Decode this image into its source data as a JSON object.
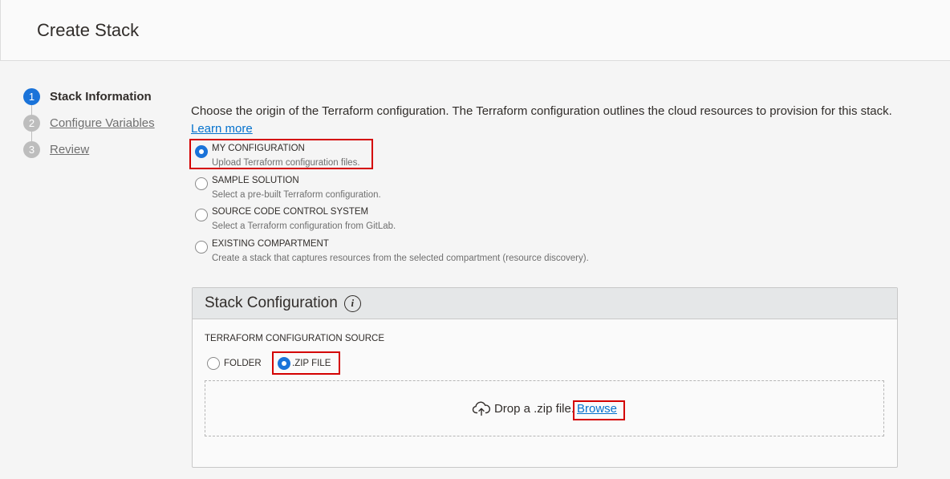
{
  "header": {
    "title": "Create Stack"
  },
  "steps": [
    {
      "number": "1",
      "label": "Stack Information",
      "active": true
    },
    {
      "number": "2",
      "label": "Configure Variables",
      "active": false
    },
    {
      "number": "3",
      "label": "Review",
      "active": false
    }
  ],
  "intro": {
    "text": "Choose the origin of the Terraform configuration. The Terraform configuration outlines the cloud resources to provision for this stack.",
    "learn_more": "Learn more"
  },
  "origin_options": [
    {
      "title": "MY CONFIGURATION",
      "description": "Upload Terraform configuration files.",
      "selected": true
    },
    {
      "title": "SAMPLE SOLUTION",
      "description": "Select a pre-built Terraform configuration.",
      "selected": false
    },
    {
      "title": "SOURCE CODE CONTROL SYSTEM",
      "description": "Select a Terraform configuration from GitLab.",
      "selected": false
    },
    {
      "title": "EXISTING COMPARTMENT",
      "description": "Create a stack that captures resources from the selected compartment (resource discovery).",
      "selected": false
    }
  ],
  "stack_config": {
    "title": "Stack Configuration",
    "info_icon": "i",
    "source_label": "TERRAFORM CONFIGURATION SOURCE",
    "folder_label": "FOLDER",
    "zip_label": ".ZIP FILE",
    "selected_source": "zip",
    "drop_text": "Drop a .zip file.",
    "browse_label": "Browse"
  },
  "colors": {
    "accent": "#1a73d9",
    "link": "#0572ce",
    "highlight": "#d40000"
  }
}
